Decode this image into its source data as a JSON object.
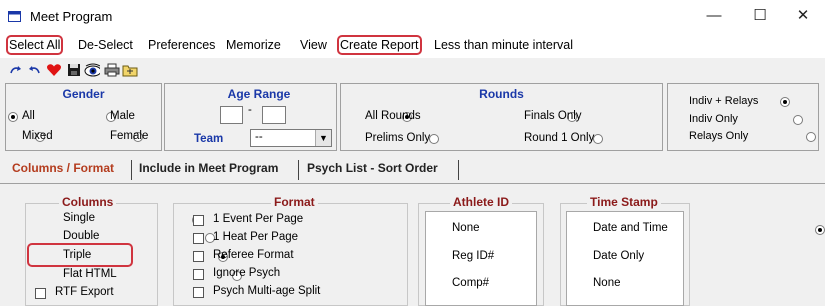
{
  "window": {
    "title": "Meet Program",
    "minimize": "—",
    "maximize": "☐",
    "close": "✕"
  },
  "menu": [
    "Select All",
    "De-Select",
    "Preferences",
    "Memorize",
    "View",
    "Create Report",
    "Less than minute interval"
  ],
  "filters": {
    "gender": {
      "title": "Gender",
      "options": [
        "All",
        "Male",
        "Mixed",
        "Female"
      ],
      "selected": "All"
    },
    "age_range": {
      "title": "Age Range",
      "from": "",
      "separator": "-",
      "to": ""
    },
    "team": {
      "label": "Team",
      "value": "--"
    },
    "rounds": {
      "title": "Rounds",
      "options": [
        "All Rounds",
        "Finals Only",
        "Prelims Only",
        "Round 1 Only"
      ],
      "selected": "All Rounds"
    },
    "relays": {
      "options": [
        "Indiv + Relays",
        "Indiv Only",
        "Relays Only"
      ],
      "selected": "Indiv + Relays"
    }
  },
  "tabs": [
    "Columns / Format",
    "Include in Meet Program",
    "Psych List - Sort Order"
  ],
  "columns_group": {
    "title": "Columns",
    "options": [
      "Single",
      "Double",
      "Triple",
      "Flat HTML"
    ],
    "selected": "Triple",
    "rtf_label": "RTF Export"
  },
  "format_group": {
    "title": "Format",
    "options": [
      "1 Event Per Page",
      "1 Heat Per Page",
      "Referee Format",
      "Ignore Psych",
      "Psych Multi-age Split"
    ]
  },
  "athlete_id_group": {
    "title": "Athlete ID",
    "options": [
      "None",
      "Reg ID#",
      "Comp#"
    ],
    "selected": "None"
  },
  "time_stamp_group": {
    "title": "Time Stamp",
    "options": [
      "Date and Time",
      "Date Only",
      "None"
    ],
    "selected": "Date and Time"
  },
  "colors": {
    "highlight": "#d0343f",
    "panel_title_blue": "#1a38a8",
    "group_title_red": "#8b1a1a",
    "active_tab": "#b43c1e"
  }
}
